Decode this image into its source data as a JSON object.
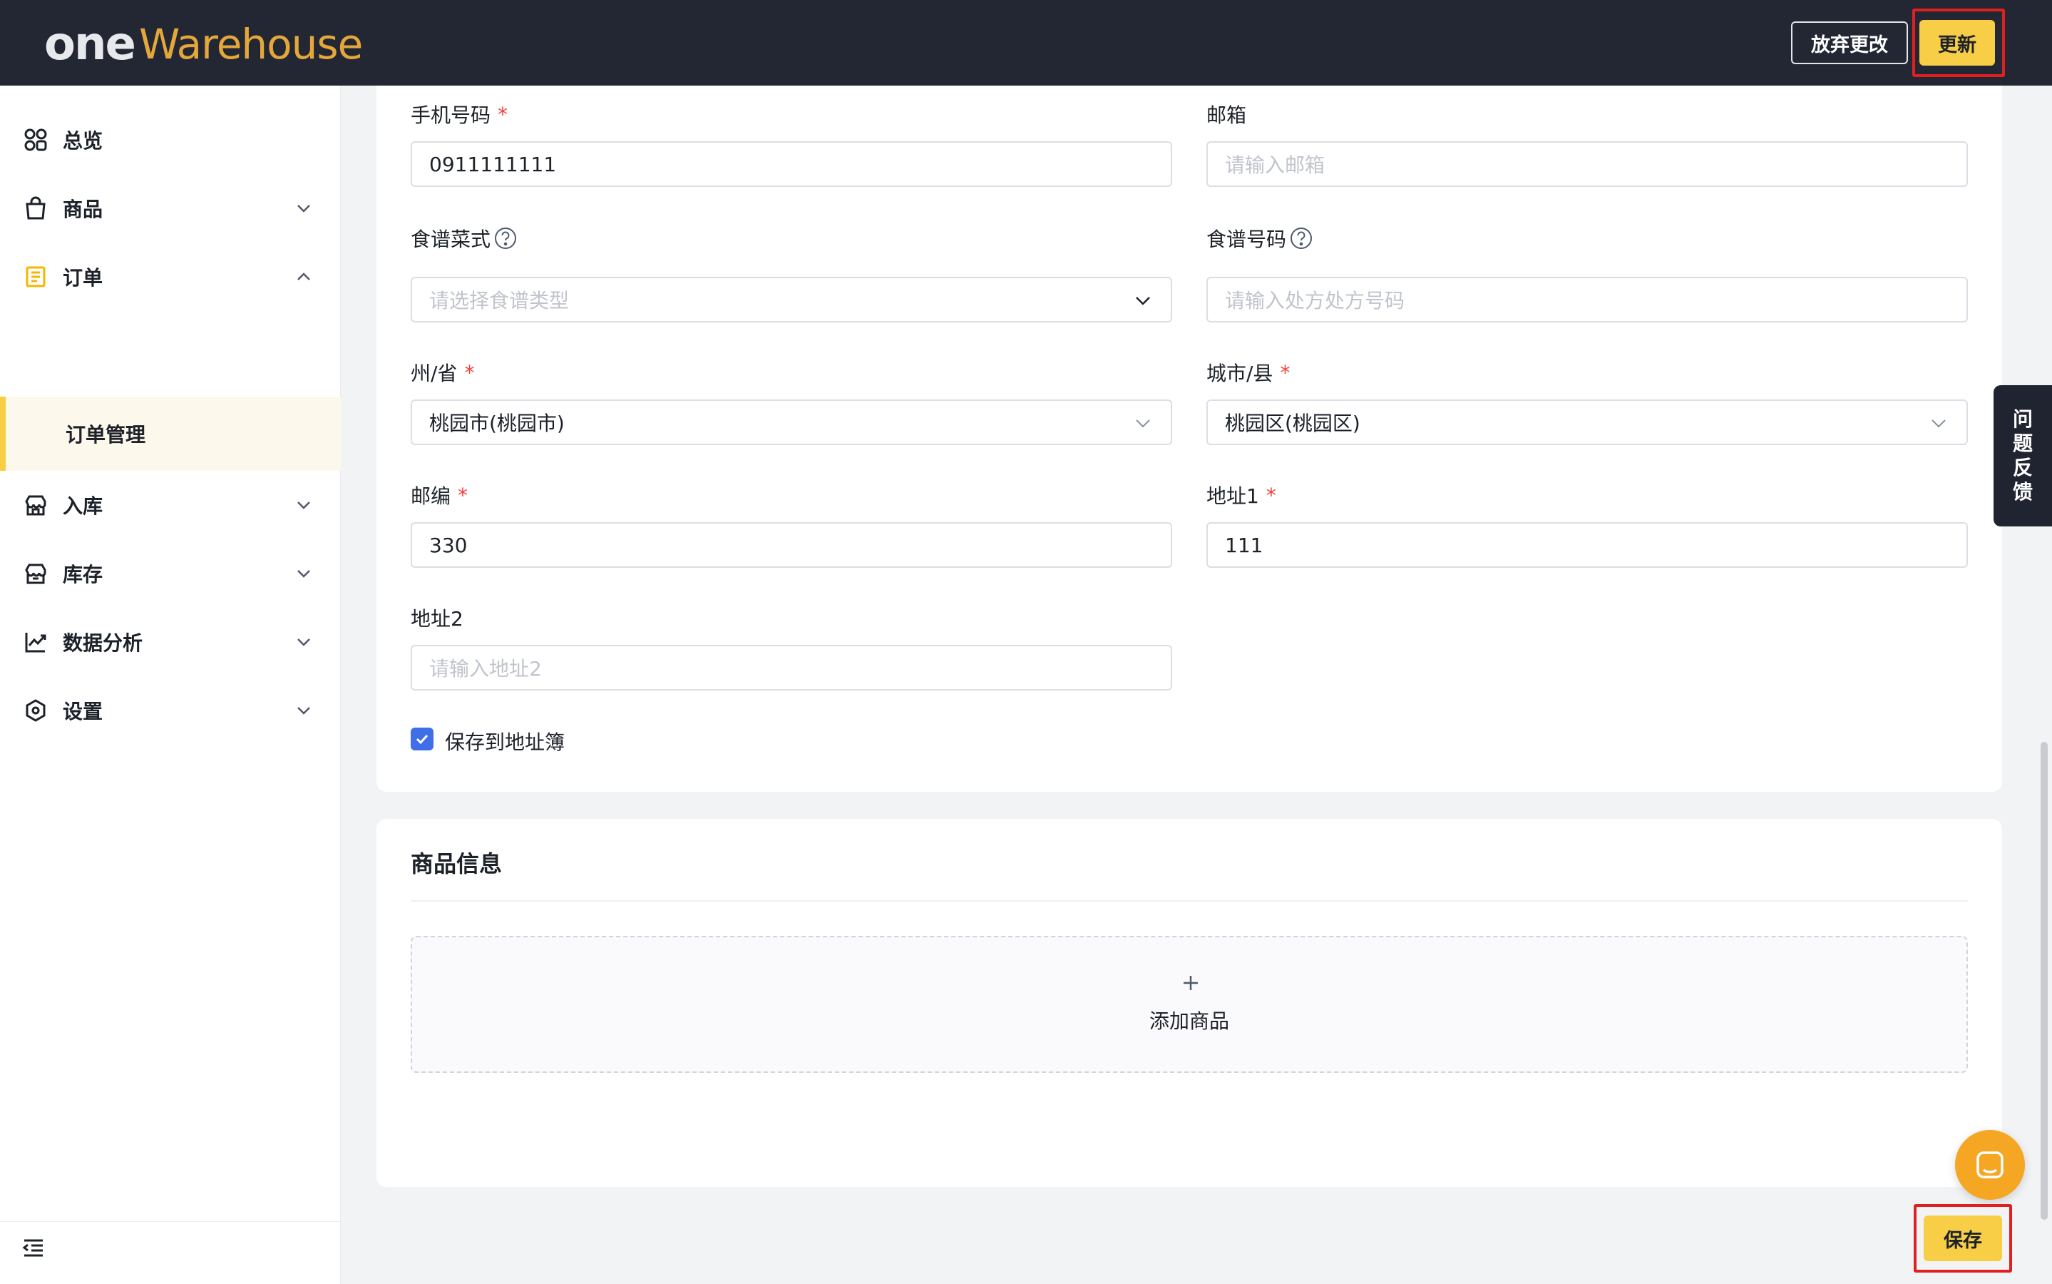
{
  "header": {
    "logo_one": "one",
    "logo_warehouse": "Warehouse",
    "discard_label": "放弃更改",
    "update_label": "更新"
  },
  "sidebar": {
    "items": [
      {
        "label": "总览",
        "icon": "dashboard-icon"
      },
      {
        "label": "商品",
        "icon": "shopping-bag-icon"
      },
      {
        "label": "订单",
        "icon": "order-icon"
      },
      {
        "label": "入库",
        "icon": "inbound-icon"
      },
      {
        "label": "库存",
        "icon": "inventory-icon"
      },
      {
        "label": "数据分析",
        "icon": "analytics-icon"
      },
      {
        "label": "设置",
        "icon": "settings-icon"
      }
    ],
    "sub_item": "订单管理"
  },
  "form": {
    "phone": {
      "label": "手机号码",
      "value": "0911111111"
    },
    "email": {
      "label": "邮箱",
      "placeholder": "请输入邮箱"
    },
    "recipe_type": {
      "label": "食谱菜式",
      "placeholder": "请选择食谱类型"
    },
    "recipe_no": {
      "label": "食谱号码",
      "placeholder": "请输入处方处方号码"
    },
    "state": {
      "label": "州/省",
      "value": "桃园市(桃园市)"
    },
    "city": {
      "label": "城市/县",
      "value": "桃园区(桃园区)"
    },
    "zip": {
      "label": "邮编",
      "value": "330"
    },
    "address1": {
      "label": "地址1",
      "value": "111"
    },
    "address2": {
      "label": "地址2",
      "placeholder": "请输入地址2"
    },
    "required_mark": "*",
    "save_to_book_label": "保存到地址簿"
  },
  "products": {
    "title": "商品信息",
    "add_label": "添加商品"
  },
  "feedback": {
    "chars": [
      "问",
      "题",
      "反",
      "馈"
    ]
  },
  "save_label": "保存",
  "colors": {
    "accent": "#f7ce46",
    "header_bg": "#232733",
    "checkbox": "#3f6fe8",
    "required": "#f53f3f",
    "chat": "#f5a623"
  }
}
